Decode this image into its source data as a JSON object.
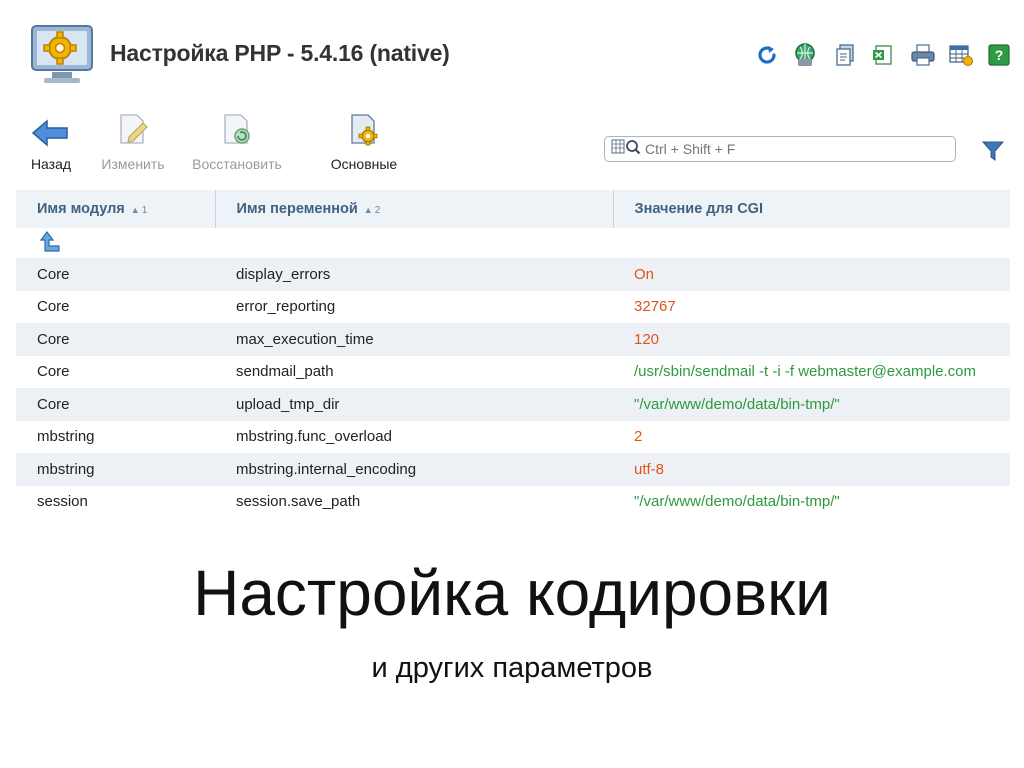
{
  "header": {
    "title": "Настройка PHP - 5.4.16 (native)",
    "app_icon": "php-settings-gear-monitor-icon",
    "tools": [
      {
        "name": "refresh-icon"
      },
      {
        "name": "network-globe-icon"
      },
      {
        "name": "copy-pages-icon"
      },
      {
        "name": "export-excel-icon"
      },
      {
        "name": "print-icon"
      },
      {
        "name": "table-settings-icon"
      },
      {
        "name": "help-icon"
      }
    ]
  },
  "toolbar": {
    "back_label": "Назад",
    "edit_label": "Изменить",
    "restore_label": "Восстановить",
    "basic_label": "Основные"
  },
  "search": {
    "placeholder": "Ctrl + Shift + F"
  },
  "table": {
    "columns": [
      {
        "label": "Имя модуля",
        "sort_order": "1"
      },
      {
        "label": "Имя переменной",
        "sort_order": "2"
      },
      {
        "label": "Значение для CGI",
        "sort_order": ""
      }
    ],
    "rows": [
      {
        "module": "Core",
        "variable": "display_errors",
        "value": "On",
        "value_color": "red"
      },
      {
        "module": "Core",
        "variable": "error_reporting",
        "value": "32767",
        "value_color": "red"
      },
      {
        "module": "Core",
        "variable": "max_execution_time",
        "value": "120",
        "value_color": "red"
      },
      {
        "module": "Core",
        "variable": "sendmail_path",
        "value": "/usr/sbin/sendmail -t -i -f webmaster@example.com",
        "value_color": "green"
      },
      {
        "module": "Core",
        "variable": "upload_tmp_dir",
        "value": "\"/var/www/demo/data/bin-tmp/\"",
        "value_color": "green"
      },
      {
        "module": "mbstring",
        "variable": "mbstring.func_overload",
        "value": "2",
        "value_color": "red"
      },
      {
        "module": "mbstring",
        "variable": "mbstring.internal_encoding",
        "value": "utf-8",
        "value_color": "red"
      },
      {
        "module": "session",
        "variable": "session.save_path",
        "value": "\"/var/www/demo/data/bin-tmp/\"",
        "value_color": "green"
      }
    ]
  },
  "slide": {
    "title": "Настройка кодировки",
    "subtitle": "и других параметров"
  },
  "colors": {
    "value_red": "#e2531b",
    "value_green": "#2c9a3d",
    "header_text": "#3f6283",
    "header_bg": "#eef3f8",
    "row_alt_bg": "#edf1f5"
  }
}
